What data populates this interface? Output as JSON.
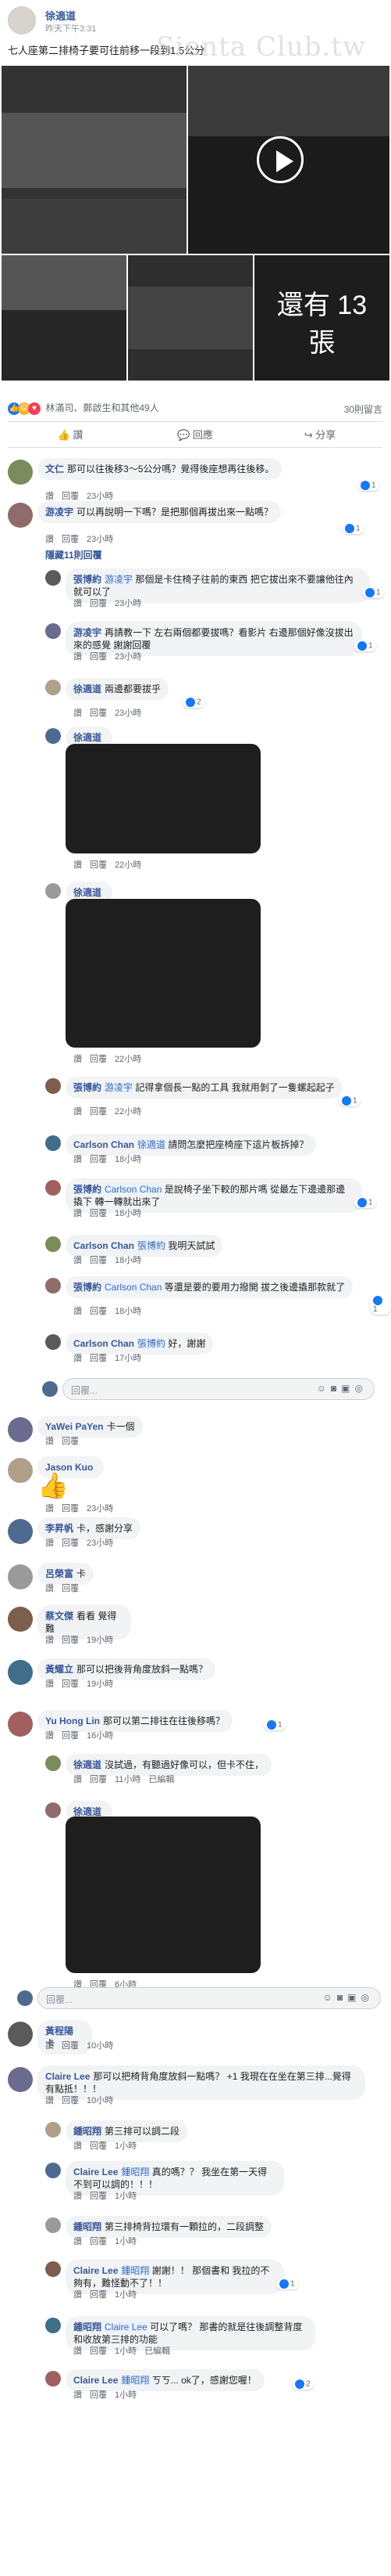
{
  "post": {
    "author": "徐適道",
    "time": "昨天下午3:31",
    "text": "七人座第二排椅子要可往前移一段到1.5公分",
    "watermark": "Sienta Club.tw",
    "more_photos": "還有 13\n張"
  },
  "stats": {
    "reactions": "林滿司、鄭啟生和其他49人",
    "comments": "30則留言"
  },
  "actions": {
    "like": "讚",
    "comment": "回應",
    "share": "分享"
  },
  "labels": {
    "like": "讚",
    "reply": "回覆",
    "hidden": "隱藏11則回覆",
    "input_placeholder": "回覆..."
  },
  "comments": [
    {
      "author": "文仁",
      "text": "那可以往後移3～5公分嗎？覺得後座想再往後移。",
      "time": "23小時",
      "likes": "1"
    },
    {
      "author": "游凌宇",
      "text": "可以再說明一下嗎？是把那個再拔出來一點嗎？",
      "time": "23小時",
      "likes": "1"
    },
    {
      "author": "張博約",
      "mention": "游凌宇",
      "text": "那個是卡住椅子往前的東西 把它拔出來不要讓他往內就可以了",
      "time": "23小時",
      "likes": "1"
    },
    {
      "author": "游凌宇",
      "text": "再請教一下 左右兩個都要拔嗎？看影片 右邊那個好像沒拔出來的感覺 謝謝回覆",
      "time": "23小時",
      "likes": "1"
    },
    {
      "author": "徐適道",
      "text": "兩邊都要拔乎",
      "time": "23小時",
      "likes": "2"
    },
    {
      "author": "徐適道",
      "text": "",
      "time": "22小時"
    },
    {
      "author": "徐適道",
      "text": "",
      "time": "22小時"
    },
    {
      "author": "張博約",
      "mention": "游凌宇",
      "text": "記得拿個長一點的工具 我就用剝了一隻螺起起子",
      "time": "22小時",
      "likes": "1"
    },
    {
      "author": "Carlson Chan",
      "mention": "徐適道",
      "text": "請問怎麼把座椅座下這片板拆掉？",
      "time": "18小時"
    },
    {
      "author": "張博約",
      "mention": "Carlson Chan",
      "text": "是說椅子坐下較的那片嗎 從最左下邊邊那邊撬下 轉一轉就出來了",
      "time": "18小時",
      "likes": "1"
    },
    {
      "author": "Carlson Chan",
      "mention": "張博約",
      "text": "我明天試試",
      "time": "18小時"
    },
    {
      "author": "張博約",
      "mention": "Carlson Chan",
      "text": "等還是要的要用力撥開 拔之後邊撬那款就了",
      "time": "18小時",
      "likes": "1"
    },
    {
      "author": "Carlson Chan",
      "mention": "張博約",
      "text": "好，謝謝",
      "time": "17小時"
    },
    {
      "author": "YaWei PaYen",
      "text": "卡一個",
      "time": ""
    },
    {
      "author": "Jason Kuo",
      "text": "",
      "time": "23小時"
    },
    {
      "author": "李昇帆",
      "text": "卡，感謝分享",
      "time": "23小時"
    },
    {
      "author": "呂榮富",
      "text": "卡",
      "time": ""
    },
    {
      "author": "蔡文傑",
      "text": "看看 覺得難",
      "time": "19小時"
    },
    {
      "author": "黃耀立",
      "text": "那可以把後背角度放斜一點嗎？",
      "time": "19小時"
    },
    {
      "author": "Yu Hong Lin",
      "text": "那可以第二排往在往後移嗎？",
      "time": "16小時",
      "likes": "1"
    },
    {
      "author": "徐適道",
      "text": "沒試過，有聽過好像可以，但卡不住，",
      "time": "11小時",
      "edited": "已編輯"
    },
    {
      "author": "徐適道",
      "text": "",
      "time": "6小時"
    },
    {
      "author": "黃程陽",
      "text": "卡",
      "time": "10小時"
    },
    {
      "author": "Claire Lee",
      "text": "那可以把椅背角度放斜一點嗎？ +1 我現在在坐在第三排...覺得有點抵！！！",
      "time": "10小時"
    },
    {
      "author": "鍾昭翔",
      "text": "第三排可以調二段",
      "time": "1小時"
    },
    {
      "author": "Claire Lee",
      "mention": "鍾昭翔",
      "text": "真的嗎？？ 我坐在第一天得不到可以調的！！！",
      "time": "1小時"
    },
    {
      "author": "鍾昭翔",
      "text": "第三排椅背拉環有一顆拉的，二段調整",
      "time": "1小時"
    },
    {
      "author": "Claire Lee",
      "mention": "鍾昭翔",
      "text": "謝謝！！ 那個書和 我拉的不夠有，難怪動不了！！",
      "time": "1小時",
      "likes": "1"
    },
    {
      "author": "鍾昭翔",
      "mention": "Claire Lee",
      "text": "可以了嗎？ 那書的就是往後調整背度 和收放第三排的功能",
      "time": "1小時",
      "edited": "已編輯"
    },
    {
      "author": "Claire Lee",
      "mention": "鍾昭翔",
      "text": "ㄎㄎ... ok了，感謝您喔！",
      "time": "1小時",
      "likes": "2"
    }
  ],
  "colors": {
    "link": "#385898",
    "bubble": "#f2f3f5",
    "like": "#1877f2"
  }
}
